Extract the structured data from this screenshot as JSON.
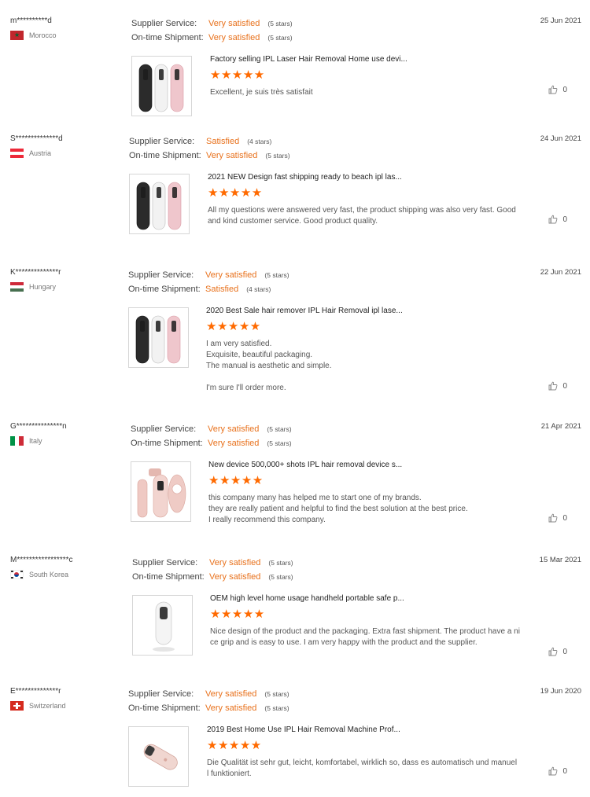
{
  "labels": {
    "supplier": "Supplier Service:",
    "ontime": "On-time Shipment:"
  },
  "colors": {
    "accent": "#e8711c",
    "star": "#ff6a00"
  },
  "reviews": [
    {
      "user": "m**********d",
      "country": "Morocco",
      "flag": "morocco",
      "supplier_value": "Very satisfied",
      "supplier_stars": "(5 stars)",
      "ontime_value": "Very satisfied",
      "ontime_stars": "(5 stars)",
      "date": "25 Jun 2021",
      "product": "Factory selling IPL Laser Hair Removal Home use devi...",
      "rating": "★★★★★",
      "comment": "Excellent, je suis très satisfait",
      "likes": "0",
      "thumb": "three"
    },
    {
      "user": "S**************d",
      "country": "Austria",
      "flag": "austria",
      "supplier_value": "Satisfied",
      "supplier_stars": "(4 stars)",
      "ontime_value": "Very satisfied",
      "ontime_stars": "(5 stars)",
      "date": "24 Jun 2021",
      "product": "2021 NEW Design fast shipping ready to beach ipl las...",
      "rating": "★★★★★",
      "comment": "All my questions were answered very fast, the product shipping was also very fast. Good and kind customer service. Good product quality.",
      "likes": "0",
      "thumb": "three"
    },
    {
      "user": "K**************r",
      "country": "Hungary",
      "flag": "hungary",
      "supplier_value": "Very satisfied",
      "supplier_stars": "(5 stars)",
      "ontime_value": "Satisfied",
      "ontime_stars": "(4 stars)",
      "date": "22 Jun 2021",
      "product": "2020 Best Sale hair remover IPL Hair Removal ipl lase...",
      "rating": "★★★★★",
      "comment": "I am very satisfied.\nExquisite, beautiful packaging.\nThe manual is aesthetic and simple.\n\nI'm sure I'll order more.",
      "likes": "0",
      "thumb": "three"
    },
    {
      "user": "G***************n",
      "country": "Italy",
      "flag": "italy",
      "supplier_value": "Very satisfied",
      "supplier_stars": "(5 stars)",
      "ontime_value": "Very satisfied",
      "ontime_stars": "(5 stars)",
      "date": "21 Apr 2021",
      "product": "New device 500,000+ shots IPL hair removal device s...",
      "rating": "★★★★★",
      "comment": "this company many has helped me to start one of my brands.\nthey are really patient and helpful to find the best solution at the best price.\nI really recommend this company.",
      "likes": "0",
      "thumb": "pink"
    },
    {
      "user": "M*****************c",
      "country": "South Korea",
      "flag": "korea",
      "supplier_value": "Very satisfied",
      "supplier_stars": "(5 stars)",
      "ontime_value": "Very satisfied",
      "ontime_stars": "(5 stars)",
      "date": "15 Mar 2021",
      "product": "OEM high level home usage handheld portable safe p...",
      "rating": "★★★★★",
      "comment": "Nice design of the product and the packaging. Extra fast shipment. The product have a nice grip and is easy to use. I am very happy with the product and the supplier.",
      "likes": "0",
      "thumb": "white"
    },
    {
      "user": "E**************r",
      "country": "Switzerland",
      "flag": "swiss",
      "supplier_value": "Very satisfied",
      "supplier_stars": "(5 stars)",
      "ontime_value": "Very satisfied",
      "ontime_stars": "(5 stars)",
      "date": "19 Jun 2020",
      "product": "2019 Best Home Use IPL Hair Removal Machine Prof...",
      "rating": "★★★★★",
      "comment": "Die Qualität ist sehr gut, leicht, komfortabel, wirklich so, dass es automatisch und manuell funktioniert.",
      "likes": "0",
      "thumb": "rosegold"
    }
  ]
}
